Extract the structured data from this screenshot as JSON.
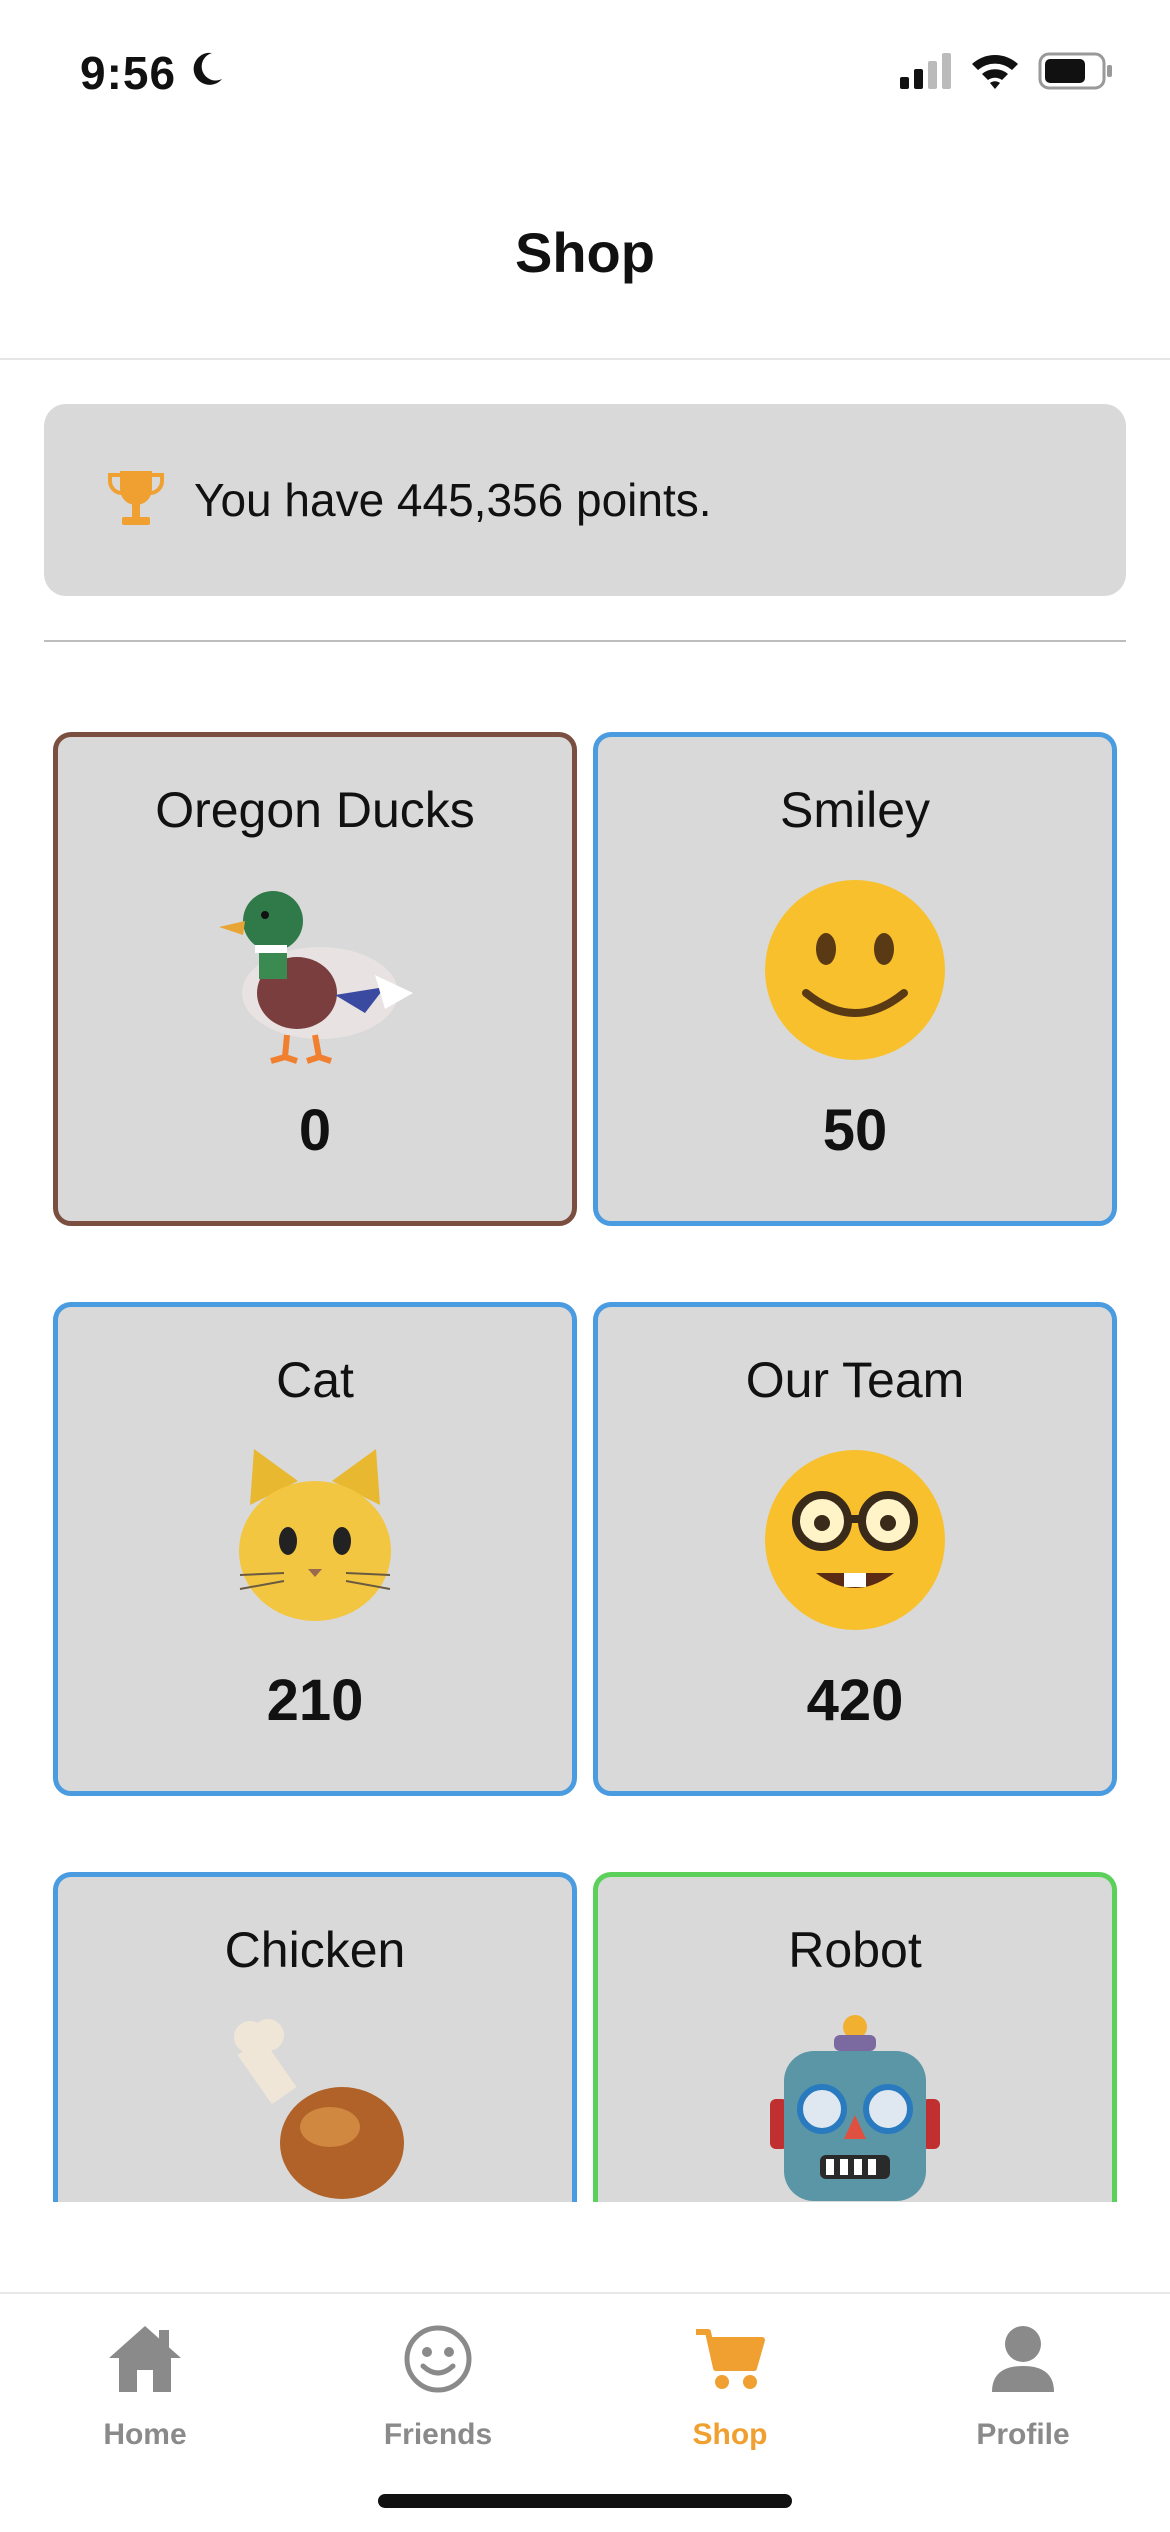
{
  "status_bar": {
    "time": "9:56",
    "icons": [
      "moon-icon",
      "cellular-signal-icon",
      "wifi-icon",
      "battery-icon"
    ]
  },
  "header": {
    "title": "Shop"
  },
  "points": {
    "text": "You have 445,356 points.",
    "icon": "trophy-icon",
    "accent": "#f0a030"
  },
  "items": [
    {
      "name": "Oregon Ducks",
      "icon": "duck-icon",
      "price": "0",
      "state": "selected",
      "border": "#7b4f3f"
    },
    {
      "name": "Smiley",
      "icon": "smiley-icon",
      "price": "50",
      "state": "available",
      "border": "#4a9be0"
    },
    {
      "name": "Cat",
      "icon": "cat-icon",
      "price": "210",
      "state": "available",
      "border": "#4a9be0"
    },
    {
      "name": "Our Team",
      "icon": "nerd-face-icon",
      "price": "420",
      "state": "available",
      "border": "#4a9be0"
    },
    {
      "name": "Chicken",
      "icon": "drumstick-icon",
      "state": "available",
      "border": "#4a9be0"
    },
    {
      "name": "Robot",
      "icon": "robot-icon",
      "state": "owned",
      "border": "#5bd05b"
    }
  ],
  "tabs": [
    {
      "label": "Home",
      "icon": "home-icon",
      "active": false
    },
    {
      "label": "Friends",
      "icon": "friends-smiley-icon",
      "active": false
    },
    {
      "label": "Shop",
      "icon": "cart-icon",
      "active": true
    },
    {
      "label": "Profile",
      "icon": "person-icon",
      "active": false
    }
  ],
  "colors": {
    "active_tab": "#f0a030",
    "inactive_tab": "#8a8a8a",
    "card_bg": "#d9d9d9"
  }
}
